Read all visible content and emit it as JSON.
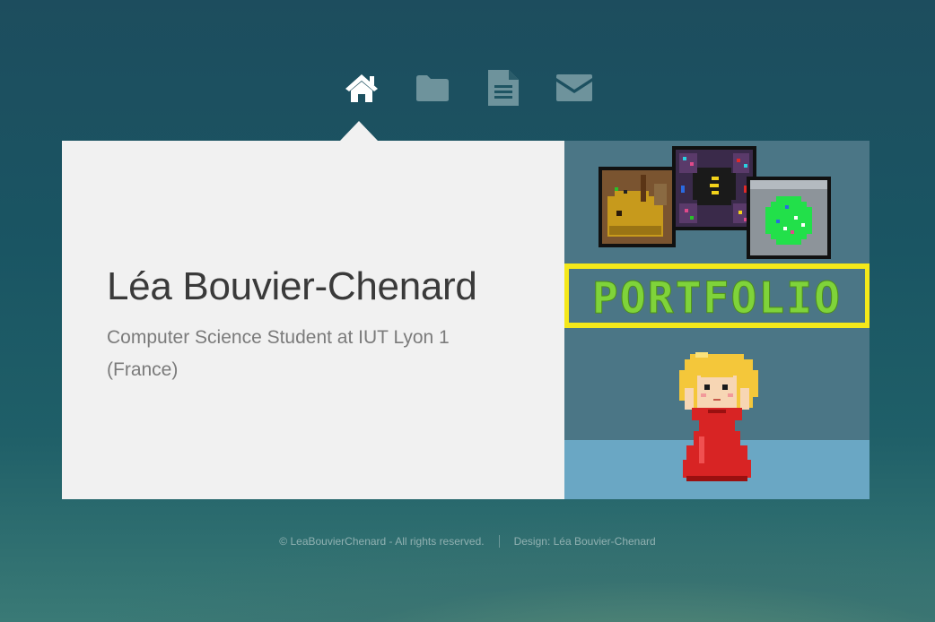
{
  "nav": {
    "items": [
      {
        "icon": "home-icon",
        "active": true
      },
      {
        "icon": "folder-icon",
        "active": false
      },
      {
        "icon": "document-icon",
        "active": false
      },
      {
        "icon": "envelope-icon",
        "active": false
      }
    ]
  },
  "profile": {
    "name": "Léa Bouvier-Chenard",
    "subtitle": "Computer Science Student at IUT Lyon 1 (France)"
  },
  "artwork": {
    "banner_text": "PORTFOLIO",
    "colors": {
      "banner_text": "#7fd33a",
      "banner_border": "#f4e81a",
      "background": "#4b7686",
      "floor": "#6aa7c4",
      "dress": "#d82424",
      "hair": "#f4c73a"
    }
  },
  "footer": {
    "copyright": "© LeaBouvierChenard - All rights reserved.",
    "design": "Design: Léa Bouvier-Chenard"
  },
  "colors": {
    "background_top": "#1d4d5e",
    "card_background": "#f1f1f1",
    "nav_active": "#ffffff",
    "nav_inactive": "#6e939c"
  }
}
